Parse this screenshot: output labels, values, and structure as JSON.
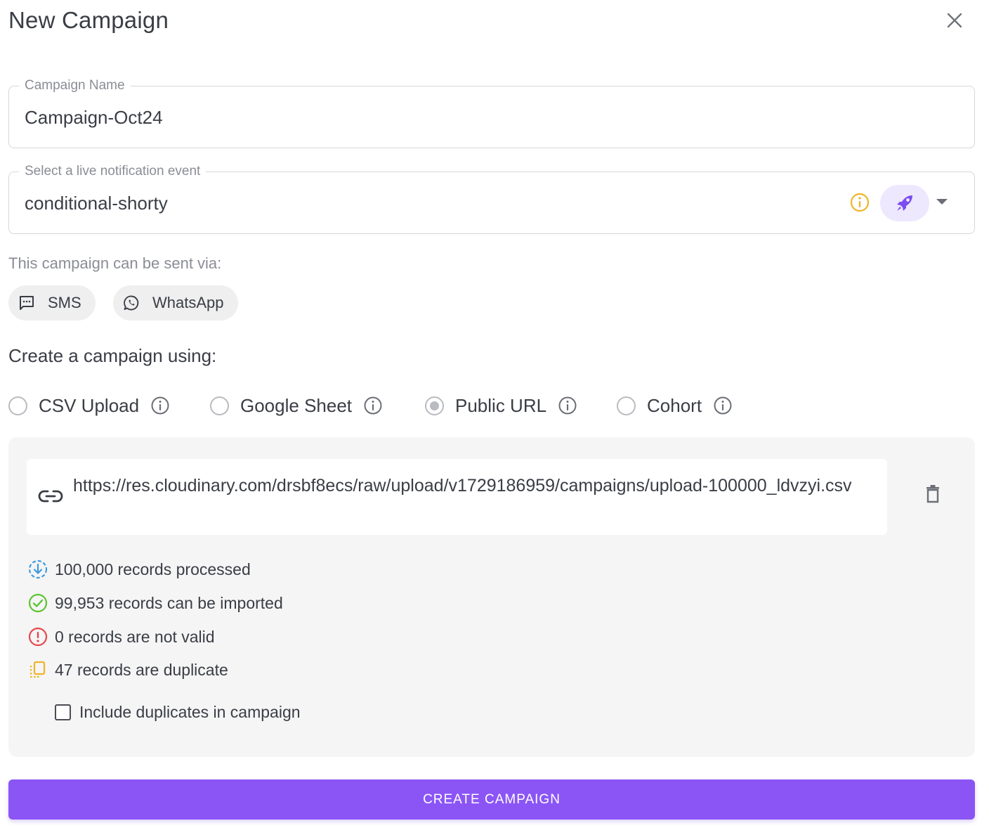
{
  "dialog": {
    "title": "New Campaign"
  },
  "campaign_name": {
    "legend": "Campaign Name",
    "value": "Campaign-Oct24"
  },
  "notification_event": {
    "legend": "Select a live notification event",
    "value": "conditional-shorty"
  },
  "channels": {
    "label": "This campaign can be sent via:",
    "items": [
      {
        "label": "SMS",
        "icon": "sms-icon"
      },
      {
        "label": "WhatsApp",
        "icon": "whatsapp-icon"
      }
    ]
  },
  "create_using": {
    "heading": "Create a campaign using:",
    "options": [
      {
        "label": "CSV Upload",
        "selected": false
      },
      {
        "label": "Google Sheet",
        "selected": false
      },
      {
        "label": "Public URL",
        "selected": true
      },
      {
        "label": "Cohort",
        "selected": false
      }
    ]
  },
  "source": {
    "url": "https://res.cloudinary.com/drsbf8ecs/raw/upload/v1729186959/campaigns/upload-100000_ldvzyi.csv"
  },
  "stats": {
    "processed": "100,000 records processed",
    "importable": "99,953 records can be imported",
    "invalid": "0 records are not valid",
    "duplicate": "47 records are duplicate"
  },
  "include_duplicates": {
    "label": "Include duplicates in campaign",
    "checked": false
  },
  "actions": {
    "create_label": "CREATE CAMPAIGN"
  },
  "colors": {
    "accent": "#8b55f6",
    "accent_light": "#ede8fd",
    "warning": "#f0b429",
    "info_blue": "#3d9be0",
    "success": "#5cc430",
    "error": "#e5484d"
  }
}
